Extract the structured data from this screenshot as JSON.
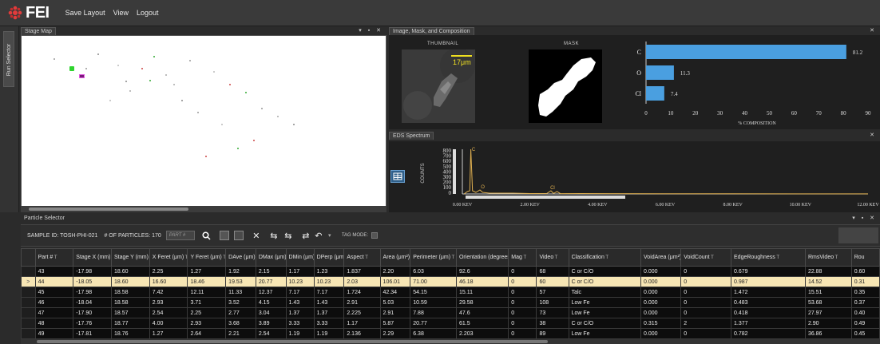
{
  "menu": {
    "logo_text": "FEI",
    "items": [
      "Save Layout",
      "View",
      "Logout"
    ]
  },
  "run_selector": {
    "label": "Run Selector"
  },
  "stage_map": {
    "title": "Stage Map",
    "controls": "▾ ▪ ✕"
  },
  "image_panel": {
    "title": "Image, Mask, and Composition",
    "thumbnail_label": "THUMBNAIL",
    "mask_label": "MASK",
    "scale_label": "17μm",
    "close": "✕"
  },
  "chart_data": {
    "type": "bar",
    "orientation": "horizontal",
    "categories": [
      "C",
      "O",
      "Cl"
    ],
    "values": [
      81.2,
      11.3,
      7.4
    ],
    "xlabel": "% COMPOSITION",
    "xlim": [
      0,
      90
    ],
    "xticks": [
      0,
      10,
      20,
      30,
      40,
      50,
      60,
      70,
      80,
      90
    ],
    "bar_color": "#4a9fe0"
  },
  "eds": {
    "title": "EDS Spectrum",
    "ylabel": "COUNTS",
    "yticks": [
      "800",
      "700",
      "600",
      "500",
      "400",
      "300",
      "200",
      "100",
      "0"
    ],
    "xticks": [
      "0.00 KEV",
      "2.00 KEV",
      "4.00 KEV",
      "6.00 KEV",
      "8.00 KEV",
      "10.00 KEV",
      "12.00 KEV"
    ],
    "peak_labels": [
      "C",
      "O",
      "Cl"
    ],
    "close": "✕"
  },
  "particle_selector": {
    "title": "Particle Selector",
    "controls": "▾ ▪ ✕",
    "sample_id_label": "SAMPLE ID:",
    "sample_id": "TOSH-PHI-021",
    "num_particles_label": "# OF PARTICLES:",
    "num_particles": "170",
    "part_placeholder": "PART #",
    "tag_mode_label": "TAG MODE:"
  },
  "table": {
    "columns": [
      "Part #",
      "Stage X (mm)",
      "Stage Y (mm)",
      "X Feret (μm)",
      "Y Feret (μm)",
      "DAve (μm)",
      "DMax (μm)",
      "DMin (μm)",
      "DPerp (μm)",
      "Aspect",
      "Area (μm²)",
      "Perimeter (μm)",
      "Orientation (degrees)",
      "Mag",
      "Video",
      "Classification",
      "VoidArea (μm²)",
      "VoidCount",
      "EdgeRoughness",
      "RmsVideo",
      "Rou"
    ],
    "rows": [
      [
        "43",
        "-17.98",
        "18.60",
        "2.25",
        "1.27",
        "1.92",
        "2.15",
        "1.17",
        "1.23",
        "1.837",
        "2.20",
        "6.03",
        "92.6",
        "0",
        "68",
        "C or C/O",
        "0.000",
        "0",
        "0.679",
        "22.88",
        "0.60"
      ],
      [
        "44",
        "-18.05",
        "18.60",
        "16.60",
        "18.46",
        "19.53",
        "20.77",
        "10.23",
        "10.23",
        "2.03",
        "106.01",
        "71.00",
        "46.18",
        "0",
        "60",
        "C or C/O",
        "0.000",
        "0",
        "0.987",
        "14.52",
        "0.31"
      ],
      [
        "45",
        "-17.98",
        "18.58",
        "7.42",
        "12.11",
        "11.33",
        "12.37",
        "7.17",
        "7.17",
        "1.724",
        "42.34",
        "54.15",
        "15.11",
        "0",
        "57",
        "Talc",
        "0.000",
        "0",
        "1.472",
        "15.51",
        "0.35"
      ],
      [
        "46",
        "-18.04",
        "18.58",
        "2.93",
        "3.71",
        "3.52",
        "4.15",
        "1.43",
        "1.43",
        "2.91",
        "5.03",
        "10.59",
        "29.58",
        "0",
        "108",
        "Low Fe",
        "0.000",
        "0",
        "0.483",
        "53.68",
        "0.37"
      ],
      [
        "47",
        "-17.90",
        "18.57",
        "2.54",
        "2.25",
        "2.77",
        "3.04",
        "1.37",
        "1.37",
        "2.225",
        "2.91",
        "7.88",
        "47.6",
        "0",
        "73",
        "Low Fe",
        "0.000",
        "0",
        "0.418",
        "27.97",
        "0.40"
      ],
      [
        "48",
        "-17.76",
        "18.77",
        "4.00",
        "2.93",
        "3.68",
        "3.89",
        "3.33",
        "3.33",
        "1.17",
        "5.87",
        "20.77",
        "61.5",
        "0",
        "38",
        "C or C/O",
        "0.315",
        "2",
        "1.377",
        "2.90",
        "0.49"
      ],
      [
        "49",
        "-17.81",
        "18.76",
        "1.27",
        "2.64",
        "2.21",
        "2.54",
        "1.19",
        "1.19",
        "2.136",
        "2.29",
        "6.38",
        "2.203",
        "0",
        "89",
        "Low Fe",
        "0.000",
        "0",
        "0.782",
        "36.86",
        "0.45"
      ]
    ],
    "selected_row": 1,
    "selected_marker": ">"
  }
}
